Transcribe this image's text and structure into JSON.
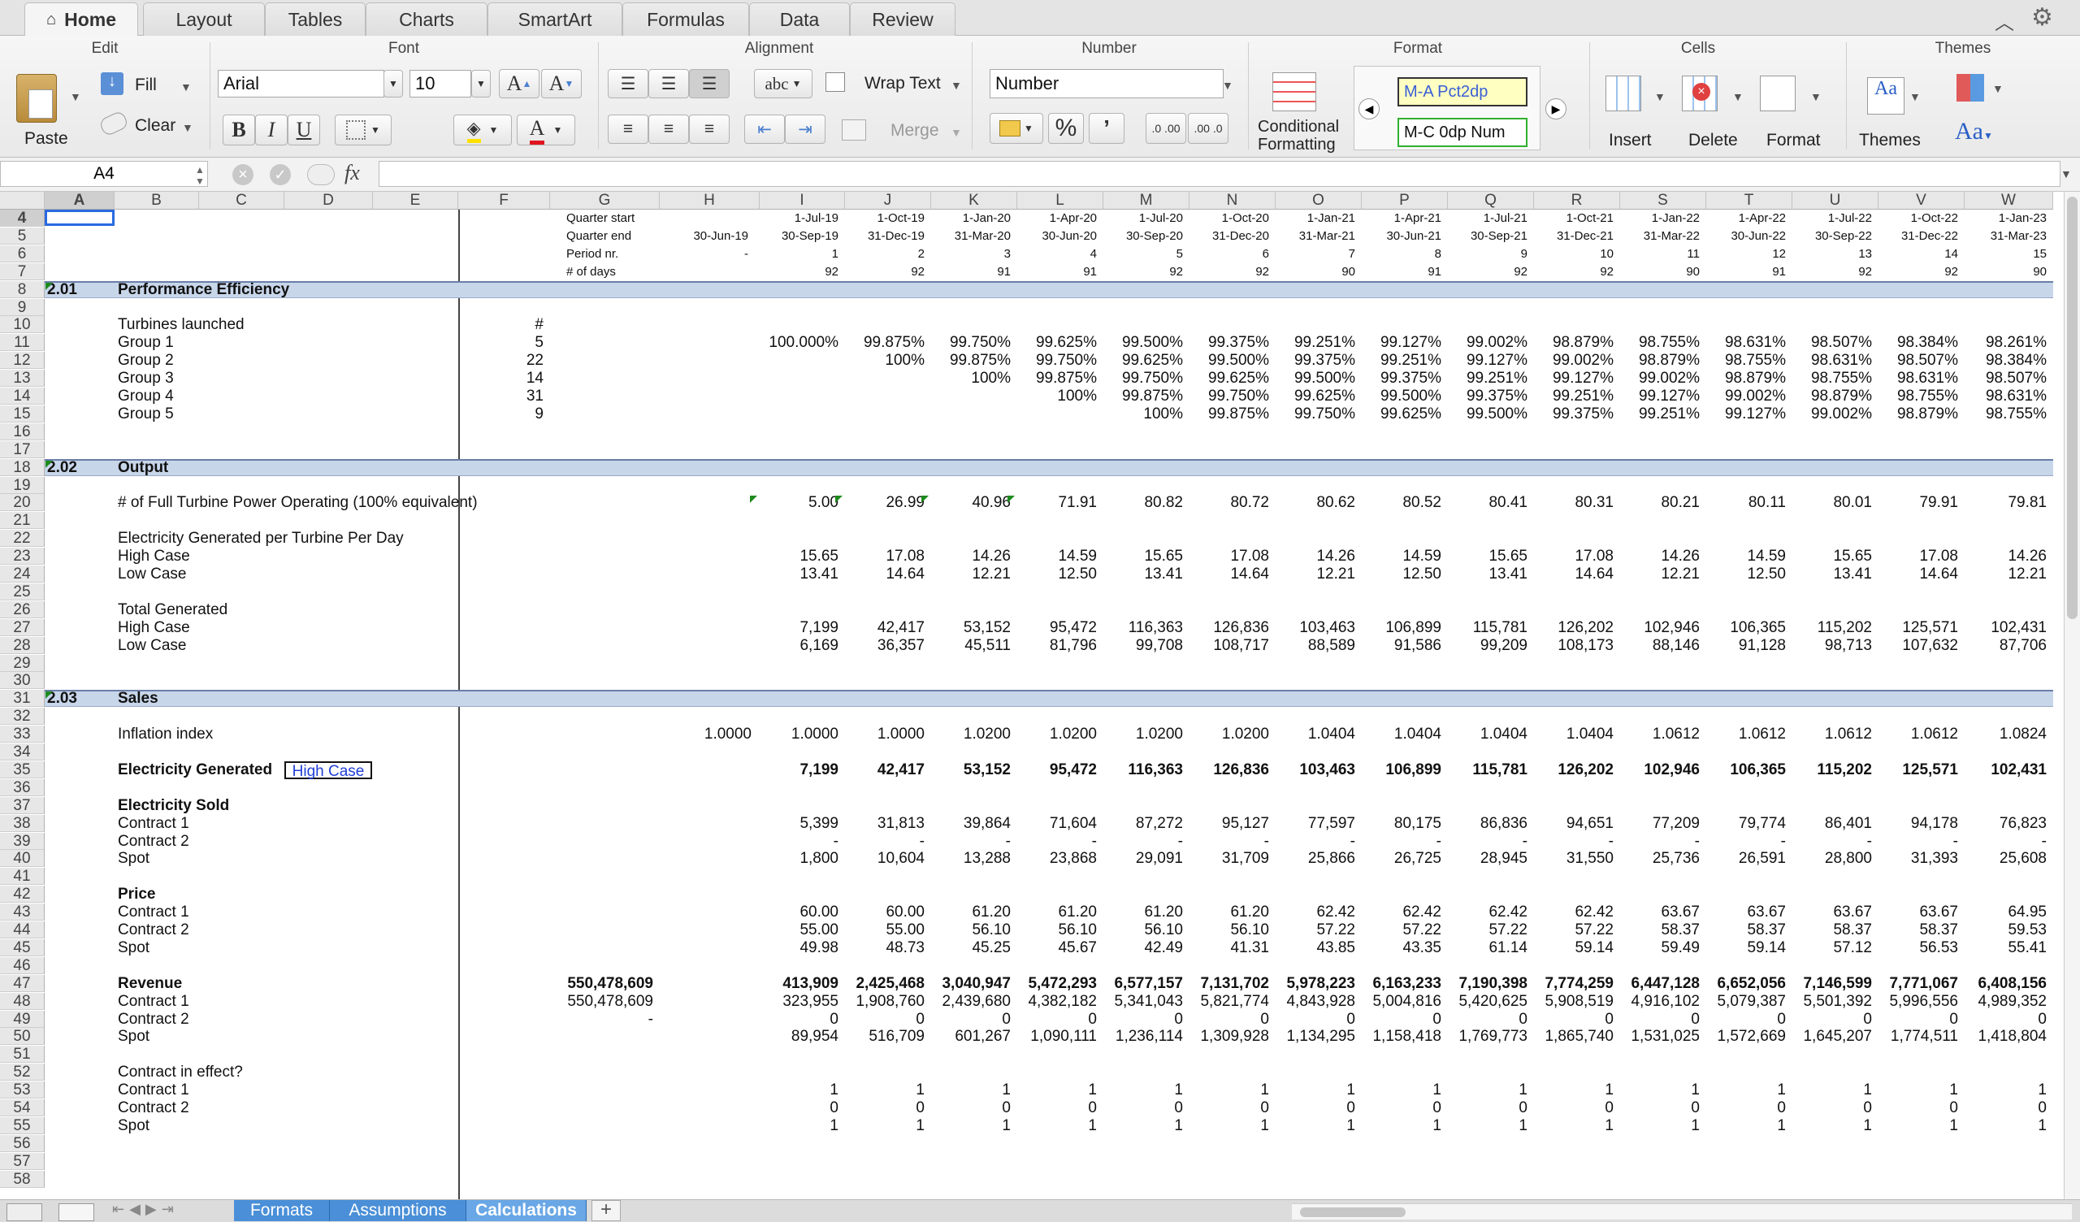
{
  "ribbon": {
    "tabs": [
      "Home",
      "Layout",
      "Tables",
      "Charts",
      "SmartArt",
      "Formulas",
      "Data",
      "Review"
    ],
    "groups": {
      "edit": "Edit",
      "font": "Font",
      "alignment": "Alignment",
      "number": "Number",
      "format": "Format",
      "cells": "Cells",
      "themes": "Themes"
    },
    "paste": "Paste",
    "fill": "Fill",
    "clear": "Clear",
    "font_name": "Arial",
    "font_size": "10",
    "wrap_text": "Wrap Text",
    "merge": "Merge",
    "number_format": "Number",
    "conditional": "Conditional",
    "formatting": "Formatting",
    "style1": "M-A Pct2dp",
    "style2": "M-C 0dp Num",
    "insert": "Insert",
    "delete": "Delete",
    "format": "Format",
    "themes": "Themes",
    "bold": "B",
    "italic": "I",
    "underline": "U",
    "abc": "abc",
    "pct": "%",
    "comma": "’",
    "dec_inc": ".0 .00",
    "dec_dec": ".00 .0",
    "font_a": "A",
    "themes_aa": "Aa"
  },
  "formula_bar": {
    "name_box": "A4",
    "fx": "fx"
  },
  "columns": [
    "A",
    "B",
    "C",
    "D",
    "E",
    "F",
    "G",
    "H",
    "I",
    "J",
    "K",
    "L",
    "M",
    "N",
    "O",
    "P",
    "Q",
    "R",
    "S",
    "T",
    "U",
    "V",
    "W"
  ],
  "rows": [
    "4",
    "5",
    "6",
    "7",
    "8",
    "9",
    "10",
    "11",
    "12",
    "13",
    "14",
    "15",
    "16",
    "17",
    "18",
    "19",
    "20",
    "21",
    "22",
    "23",
    "24",
    "25",
    "26",
    "27",
    "28",
    "29",
    "30",
    "31",
    "32",
    "33",
    "34",
    "35",
    "36",
    "37",
    "38",
    "39",
    "40",
    "41",
    "42",
    "43",
    "44",
    "45",
    "46",
    "47",
    "48",
    "49",
    "50",
    "51",
    "52",
    "53",
    "54",
    "55",
    "56",
    "57",
    "58"
  ],
  "header_labels": [
    "Quarter start",
    "Quarter end",
    "Period nr.",
    "# of days"
  ],
  "h_col": [
    "",
    "30-Jun-19",
    "-",
    ""
  ],
  "quarter_start": [
    "1-Jul-19",
    "1-Oct-19",
    "1-Jan-20",
    "1-Apr-20",
    "1-Jul-20",
    "1-Oct-20",
    "1-Jan-21",
    "1-Apr-21",
    "1-Jul-21",
    "1-Oct-21",
    "1-Jan-22",
    "1-Apr-22",
    "1-Jul-22",
    "1-Oct-22",
    "1-Jan-23"
  ],
  "quarter_end": [
    "30-Sep-19",
    "31-Dec-19",
    "31-Mar-20",
    "30-Jun-20",
    "30-Sep-20",
    "31-Dec-20",
    "31-Mar-21",
    "30-Jun-21",
    "30-Sep-21",
    "31-Dec-21",
    "31-Mar-22",
    "30-Jun-22",
    "30-Sep-22",
    "31-Dec-22",
    "31-Mar-23"
  ],
  "period_nr": [
    "1",
    "2",
    "3",
    "4",
    "5",
    "6",
    "7",
    "8",
    "9",
    "10",
    "11",
    "12",
    "13",
    "14",
    "15"
  ],
  "days": [
    "92",
    "92",
    "91",
    "91",
    "92",
    "92",
    "90",
    "91",
    "92",
    "92",
    "90",
    "91",
    "92",
    "92",
    "90"
  ],
  "sections": [
    {
      "num": "2.01",
      "title": "Performance Efficiency"
    },
    {
      "num": "2.02",
      "title": "Output"
    },
    {
      "num": "2.03",
      "title": "Sales"
    }
  ],
  "turbines": {
    "label": "Turbines launched",
    "unit": "#",
    "groups": [
      {
        "name": "Group 1",
        "count": "5",
        "values": [
          "100.000%",
          "99.875%",
          "99.750%",
          "99.625%",
          "99.500%",
          "99.375%",
          "99.251%",
          "99.127%",
          "99.002%",
          "98.879%",
          "98.755%",
          "98.631%",
          "98.507%",
          "98.384%",
          "98.261%"
        ]
      },
      {
        "name": "Group 2",
        "count": "22",
        "values": [
          "",
          "100%",
          "99.875%",
          "99.750%",
          "99.625%",
          "99.500%",
          "99.375%",
          "99.251%",
          "99.127%",
          "99.002%",
          "98.879%",
          "98.755%",
          "98.631%",
          "98.507%",
          "98.384%"
        ]
      },
      {
        "name": "Group 3",
        "count": "14",
        "values": [
          "",
          "",
          "100%",
          "99.875%",
          "99.750%",
          "99.625%",
          "99.500%",
          "99.375%",
          "99.251%",
          "99.127%",
          "99.002%",
          "98.879%",
          "98.755%",
          "98.631%",
          "98.507%"
        ]
      },
      {
        "name": "Group 4",
        "count": "31",
        "values": [
          "",
          "",
          "",
          "100%",
          "99.875%",
          "99.750%",
          "99.625%",
          "99.500%",
          "99.375%",
          "99.251%",
          "99.127%",
          "99.002%",
          "98.879%",
          "98.755%",
          "98.631%"
        ]
      },
      {
        "name": "Group 5",
        "count": "9",
        "values": [
          "",
          "",
          "",
          "",
          "100%",
          "99.875%",
          "99.750%",
          "99.625%",
          "99.500%",
          "99.375%",
          "99.251%",
          "99.127%",
          "99.002%",
          "98.879%",
          "98.755%"
        ]
      }
    ]
  },
  "output": {
    "full_label": "# of Full Turbine Power Operating (100% equivalent)",
    "full": [
      "5.00",
      "26.99",
      "40.96",
      "71.91",
      "80.82",
      "80.72",
      "80.62",
      "80.52",
      "80.41",
      "80.31",
      "80.21",
      "80.11",
      "80.01",
      "79.91",
      "79.81"
    ],
    "epd_label": "Electricity Generated per Turbine Per Day",
    "high_label": "High Case",
    "low_label": "Low Case",
    "epd_high": [
      "15.65",
      "17.08",
      "14.26",
      "14.59",
      "15.65",
      "17.08",
      "14.26",
      "14.59",
      "15.65",
      "17.08",
      "14.26",
      "14.59",
      "15.65",
      "17.08",
      "14.26"
    ],
    "epd_low": [
      "13.41",
      "14.64",
      "12.21",
      "12.50",
      "13.41",
      "14.64",
      "12.21",
      "12.50",
      "13.41",
      "14.64",
      "12.21",
      "12.50",
      "13.41",
      "14.64",
      "12.21"
    ],
    "total_label": "Total Generated",
    "tot_high": [
      "7,199",
      "42,417",
      "53,152",
      "95,472",
      "116,363",
      "126,836",
      "103,463",
      "106,899",
      "115,781",
      "126,202",
      "102,946",
      "106,365",
      "115,202",
      "125,571",
      "102,431"
    ],
    "tot_low": [
      "6,169",
      "36,357",
      "45,511",
      "81,796",
      "99,708",
      "108,717",
      "88,589",
      "91,586",
      "99,209",
      "108,173",
      "88,146",
      "91,128",
      "98,713",
      "107,632",
      "87,706"
    ]
  },
  "sales": {
    "inflation_label": "Inflation index",
    "inflation_h": "1.0000",
    "inflation": [
      "1.0000",
      "1.0000",
      "1.0200",
      "1.0200",
      "1.0200",
      "1.0200",
      "1.0404",
      "1.0404",
      "1.0404",
      "1.0404",
      "1.0612",
      "1.0612",
      "1.0612",
      "1.0612",
      "1.0824"
    ],
    "eg_label": "Electricity Generated",
    "eg_case": "High Case",
    "eg": [
      "7,199",
      "42,417",
      "53,152",
      "95,472",
      "116,363",
      "126,836",
      "103,463",
      "106,899",
      "115,781",
      "126,202",
      "102,946",
      "106,365",
      "115,202",
      "125,571",
      "102,431"
    ],
    "sold_label": "Electricity Sold",
    "c1_label": "Contract 1",
    "c2_label": "Contract 2",
    "spot_label": "Spot",
    "sold_c1": [
      "5,399",
      "31,813",
      "39,864",
      "71,604",
      "87,272",
      "95,127",
      "77,597",
      "80,175",
      "86,836",
      "94,651",
      "77,209",
      "79,774",
      "86,401",
      "94,178",
      "76,823"
    ],
    "sold_c2": [
      "-",
      "-",
      "-",
      "-",
      "-",
      "-",
      "-",
      "-",
      "-",
      "-",
      "-",
      "-",
      "-",
      "-",
      "-"
    ],
    "sold_spot": [
      "1,800",
      "10,604",
      "13,288",
      "23,868",
      "29,091",
      "31,709",
      "25,866",
      "26,725",
      "28,945",
      "31,550",
      "25,736",
      "26,591",
      "28,800",
      "31,393",
      "25,608"
    ],
    "price_label": "Price",
    "price_c1": [
      "60.00",
      "60.00",
      "61.20",
      "61.20",
      "61.20",
      "61.20",
      "62.42",
      "62.42",
      "62.42",
      "62.42",
      "63.67",
      "63.67",
      "63.67",
      "63.67",
      "64.95"
    ],
    "price_c2": [
      "55.00",
      "55.00",
      "56.10",
      "56.10",
      "56.10",
      "56.10",
      "57.22",
      "57.22",
      "57.22",
      "57.22",
      "58.37",
      "58.37",
      "58.37",
      "58.37",
      "59.53"
    ],
    "price_spot": [
      "49.98",
      "48.73",
      "45.25",
      "45.67",
      "42.49",
      "41.31",
      "43.85",
      "43.35",
      "61.14",
      "59.14",
      "59.49",
      "59.14",
      "57.12",
      "56.53",
      "55.41"
    ],
    "rev_label": "Revenue",
    "rev_total": "550,478,609",
    "rev_c1_total": "550,478,609",
    "rev_c2_total": "-",
    "rev": [
      "413,909",
      "2,425,468",
      "3,040,947",
      "5,472,293",
      "6,577,157",
      "7,131,702",
      "5,978,223",
      "6,163,233",
      "7,190,398",
      "7,774,259",
      "6,447,128",
      "6,652,056",
      "7,146,599",
      "7,771,067",
      "6,408,156"
    ],
    "rev_c1": [
      "323,955",
      "1,908,760",
      "2,439,680",
      "4,382,182",
      "5,341,043",
      "5,821,774",
      "4,843,928",
      "5,004,816",
      "5,420,625",
      "5,908,519",
      "4,916,102",
      "5,079,387",
      "5,501,392",
      "5,996,556",
      "4,989,352"
    ],
    "rev_c2": [
      "0",
      "0",
      "0",
      "0",
      "0",
      "0",
      "0",
      "0",
      "0",
      "0",
      "0",
      "0",
      "0",
      "0",
      "0"
    ],
    "rev_spot": [
      "89,954",
      "516,709",
      "601,267",
      "1,090,111",
      "1,236,114",
      "1,309,928",
      "1,134,295",
      "1,158,418",
      "1,769,773",
      "1,865,740",
      "1,531,025",
      "1,572,669",
      "1,645,207",
      "1,774,511",
      "1,418,804"
    ],
    "cie_label": "Contract in effect?",
    "cie_c1": [
      "1",
      "1",
      "1",
      "1",
      "1",
      "1",
      "1",
      "1",
      "1",
      "1",
      "1",
      "1",
      "1",
      "1",
      "1"
    ],
    "cie_c2": [
      "0",
      "0",
      "0",
      "0",
      "0",
      "0",
      "0",
      "0",
      "0",
      "0",
      "0",
      "0",
      "0",
      "0",
      "0"
    ],
    "cie_spot": [
      "1",
      "1",
      "1",
      "1",
      "1",
      "1",
      "1",
      "1",
      "1",
      "1",
      "1",
      "1",
      "1",
      "1",
      "1"
    ]
  },
  "sheet_tabs": [
    "Formats",
    "Assumptions",
    "Calculations"
  ],
  "add_sheet": "+"
}
